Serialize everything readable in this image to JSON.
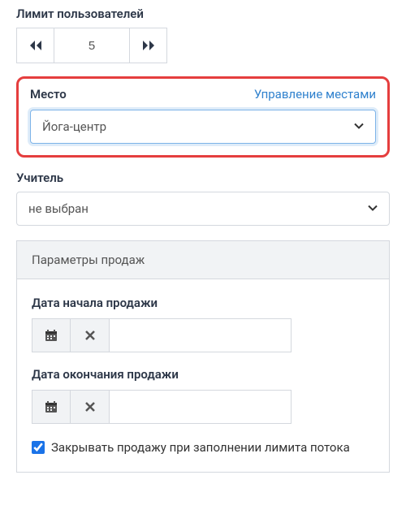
{
  "userLimit": {
    "label": "Лимит пользователей",
    "value": "5"
  },
  "placeSection": {
    "label": "Место",
    "manageLink": "Управление местами",
    "selected": "Йога-центр"
  },
  "teacherSection": {
    "label": "Учитель",
    "selected": "не выбран"
  },
  "salesPanel": {
    "title": "Параметры продаж",
    "startDate": {
      "label": "Дата начала продажи",
      "value": ""
    },
    "endDate": {
      "label": "Дата окончания продажи",
      "value": ""
    },
    "closeOnLimit": {
      "label": "Закрывать продажу при заполнении лимита потока",
      "checked": true
    }
  }
}
